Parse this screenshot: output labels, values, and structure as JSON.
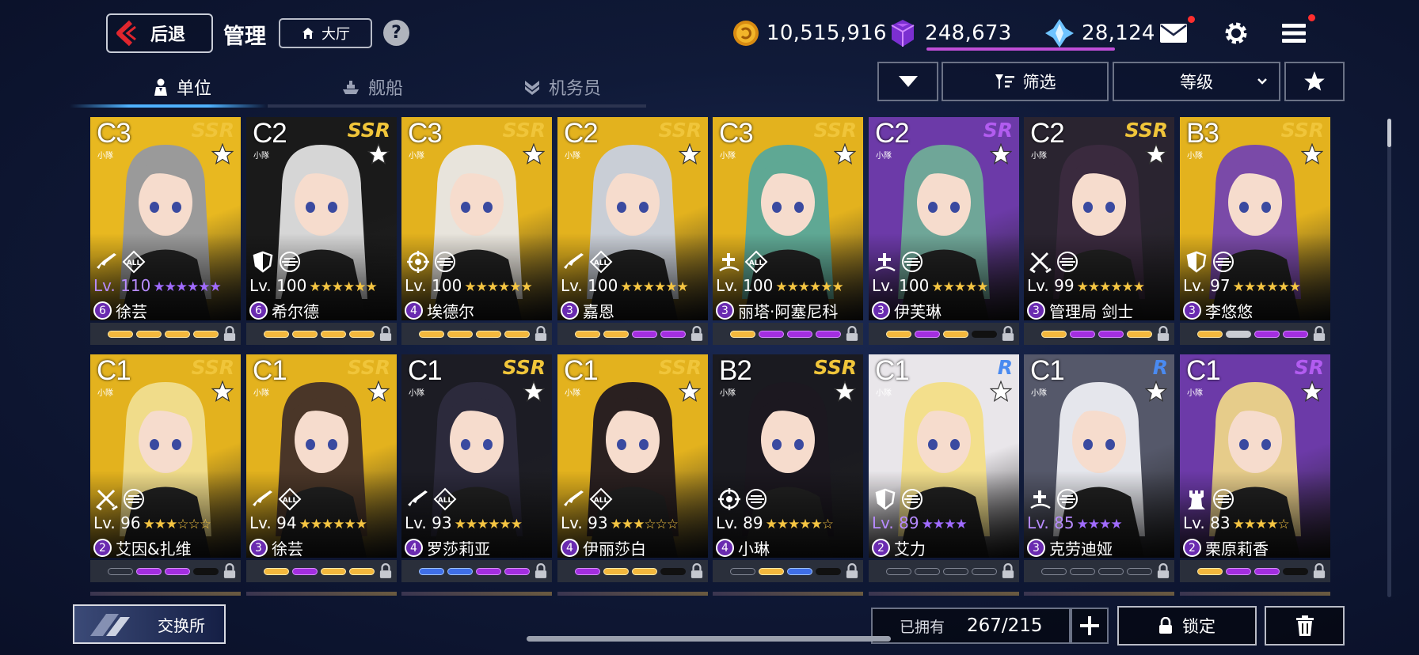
{
  "header": {
    "back_label": "后退",
    "title": "管理",
    "hall_label": "大厅",
    "help_label": "?"
  },
  "currencies": {
    "gold": "10,515,916",
    "purple": "248,673",
    "blue": "28,124"
  },
  "tabs": [
    {
      "label": "单位",
      "active": true
    },
    {
      "label": "舰船",
      "active": false
    },
    {
      "label": "机务员",
      "active": false
    }
  ],
  "filters": {
    "filter_label": "筛选",
    "sort_label": "等级"
  },
  "cards": [
    {
      "cls": "C3",
      "sub": "小隊",
      "rarity": "SSR",
      "lv": "Lv. 110",
      "stars": "★★★★★★",
      "stars_color": "#a06bff",
      "lv_color": "#b78bff",
      "rank": "6",
      "name": "徐芸",
      "bg": "#e8b820",
      "hair": "#9a9a9a",
      "roles": [
        "rifle",
        "all"
      ],
      "pills": [
        "o",
        "o",
        "o",
        "o"
      ]
    },
    {
      "cls": "C2",
      "sub": "小隊",
      "rarity": "SSR",
      "lv": "Lv. 100",
      "stars": "★★★★★★",
      "stars_color": "#f5c542",
      "lv_color": "#ffffff",
      "rank": "6",
      "name": "希尔德",
      "bg": "#1a1a1a",
      "hair": "#d6d6d6",
      "roles": [
        "shield",
        "squad"
      ],
      "pills": [
        "o",
        "o",
        "o",
        "o"
      ]
    },
    {
      "cls": "C3",
      "sub": "小隊",
      "rarity": "SSR",
      "lv": "Lv. 100",
      "stars": "★★★★★★",
      "stars_color": "#f5c542",
      "lv_color": "#ffffff",
      "rank": "4",
      "name": "埃德尔",
      "bg": "#e3b21e",
      "hair": "#e8e4dc",
      "roles": [
        "target",
        "squad"
      ],
      "pills": [
        "o",
        "o",
        "o",
        "o"
      ]
    },
    {
      "cls": "C2",
      "sub": "小隊",
      "rarity": "SSR",
      "lv": "Lv. 100",
      "stars": "★★★★★★",
      "stars_color": "#f5c542",
      "lv_color": "#ffffff",
      "rank": "3",
      "name": "嘉恩",
      "bg": "#e3b21e",
      "hair": "#c9ced6",
      "roles": [
        "rifle",
        "all"
      ],
      "pills": [
        "o",
        "o",
        "p",
        "p"
      ]
    },
    {
      "cls": "C3",
      "sub": "小隊",
      "rarity": "SSR",
      "lv": "Lv. 100",
      "stars": "★★★★★★",
      "stars_color": "#f5c542",
      "lv_color": "#ffffff",
      "rank": "3",
      "name": "丽塔·阿塞尼科",
      "bg": "#e3b21e",
      "hair": "#5fa894",
      "roles": [
        "heal",
        "all"
      ],
      "pills": [
        "o",
        "p",
        "p",
        "p"
      ]
    },
    {
      "cls": "C2",
      "sub": "小隊",
      "rarity": "SR",
      "lv": "Lv. 100",
      "stars": "★★★★★",
      "stars_color": "#f5c542",
      "lv_color": "#ffffff",
      "rank": "3",
      "name": "伊芙琳",
      "bg": "#6c3aa8",
      "hair": "#6fa698",
      "roles": [
        "heal",
        "squad"
      ],
      "pills": [
        "o",
        "p",
        "o",
        "k"
      ]
    },
    {
      "cls": "C2",
      "sub": "小隊",
      "rarity": "SSR",
      "lv": "Lv. 99",
      "stars": "★★★★★★",
      "stars_color": "#f5c542",
      "lv_color": "#ffffff",
      "rank": "3",
      "name": "管理局 剑士",
      "bg": "#2a2430",
      "hair": "#3a2a3e",
      "roles": [
        "sword",
        "squad"
      ],
      "pills": [
        "o",
        "p",
        "p",
        "o"
      ]
    },
    {
      "cls": "B3",
      "sub": "小隊",
      "rarity": "SSR",
      "lv": "Lv. 97",
      "stars": "★★★★★★",
      "stars_color": "#f5c542",
      "lv_color": "#ffffff",
      "rank": "3",
      "name": "李悠悠",
      "bg": "#e3b21e",
      "hair": "#7a4aa8",
      "roles": [
        "shield",
        "squad"
      ],
      "pills": [
        "o",
        "w",
        "p",
        "p"
      ]
    },
    {
      "cls": "C1",
      "sub": "小隊",
      "rarity": "SSR",
      "lv": "Lv. 96",
      "stars": "★★★☆☆☆",
      "stars_color": "#f5c542",
      "lv_color": "#ffffff",
      "rank": "2",
      "name": "艾因&扎维",
      "bg": "#e3b21e",
      "hair": "#f0dc8a",
      "roles": [
        "sword",
        "squad"
      ],
      "pills": [
        "e",
        "p",
        "p",
        "k"
      ]
    },
    {
      "cls": "C1",
      "sub": "小隊",
      "rarity": "SSR",
      "lv": "Lv. 94",
      "stars": "★★★★★★",
      "stars_color": "#f5c542",
      "lv_color": "#ffffff",
      "rank": "3",
      "name": "徐芸",
      "bg": "#e3b21e",
      "hair": "#4a3628",
      "roles": [
        "rifle",
        "all"
      ],
      "pills": [
        "o",
        "p",
        "o",
        "o"
      ]
    },
    {
      "cls": "C1",
      "sub": "小隊",
      "rarity": "SSR",
      "lv": "Lv. 93",
      "stars": "★★★★★★",
      "stars_color": "#f5c542",
      "lv_color": "#ffffff",
      "rank": "4",
      "name": "罗莎莉亚",
      "bg": "#1c1c24",
      "hair": "#2c2a3c",
      "roles": [
        "rifle",
        "all"
      ],
      "pills": [
        "b",
        "b",
        "p",
        "p"
      ]
    },
    {
      "cls": "C1",
      "sub": "小隊",
      "rarity": "SSR",
      "lv": "Lv. 93",
      "stars": "★★★☆☆☆",
      "stars_color": "#f5c542",
      "lv_color": "#ffffff",
      "rank": "4",
      "name": "伊丽莎白",
      "bg": "#e3b21e",
      "hair": "#2a2020",
      "roles": [
        "rifle",
        "all"
      ],
      "pills": [
        "p",
        "o",
        "o",
        "k"
      ]
    },
    {
      "cls": "B2",
      "sub": "小隊",
      "rarity": "SSR",
      "lv": "Lv. 89",
      "stars": "★★★★★☆",
      "stars_color": "#f5c542",
      "lv_color": "#ffffff",
      "rank": "4",
      "name": "小琳",
      "bg": "#1a1a20",
      "hair": "#1c1820",
      "roles": [
        "target",
        "squad"
      ],
      "pills": [
        "e",
        "o",
        "b",
        "k"
      ]
    },
    {
      "cls": "C1",
      "sub": "小隊",
      "rarity": "R",
      "lv": "Lv. 89",
      "stars": "★★★★",
      "stars_color": "#a06bff",
      "lv_color": "#b78bff",
      "rank": "2",
      "name": "艾力",
      "bg": "#e9e6ea",
      "hair": "#f3df8c",
      "roles": [
        "shield",
        "squad"
      ],
      "pills": [
        "e",
        "e",
        "e",
        "e"
      ]
    },
    {
      "cls": "C1",
      "sub": "小隊",
      "rarity": "R",
      "lv": "Lv. 85",
      "stars": "★★★★",
      "stars_color": "#a06bff",
      "lv_color": "#b78bff",
      "rank": "3",
      "name": "克劳迪娅",
      "bg": "#55586a",
      "hair": "#e5e6ec",
      "roles": [
        "heal",
        "squad"
      ],
      "pills": [
        "e",
        "e",
        "e",
        "e"
      ]
    },
    {
      "cls": "C1",
      "sub": "小隊",
      "rarity": "SR",
      "lv": "Lv. 83",
      "stars": "★★★★☆",
      "stars_color": "#f5c542",
      "lv_color": "#ffffff",
      "rank": "2",
      "name": "栗原莉香",
      "bg": "#6c3aa8",
      "hair": "#e6cc8a",
      "roles": [
        "rook",
        "squad"
      ],
      "pills": [
        "o",
        "p",
        "p",
        "k"
      ]
    }
  ],
  "rarity_colors": {
    "SSR": "#f0c53a",
    "SR": "#b25cf0",
    "R": "#4a8af0"
  },
  "bottom": {
    "exchange_label": "交换所",
    "owned_label": "已拥有",
    "owned_count": "267/215",
    "lock_label": "锁定"
  }
}
